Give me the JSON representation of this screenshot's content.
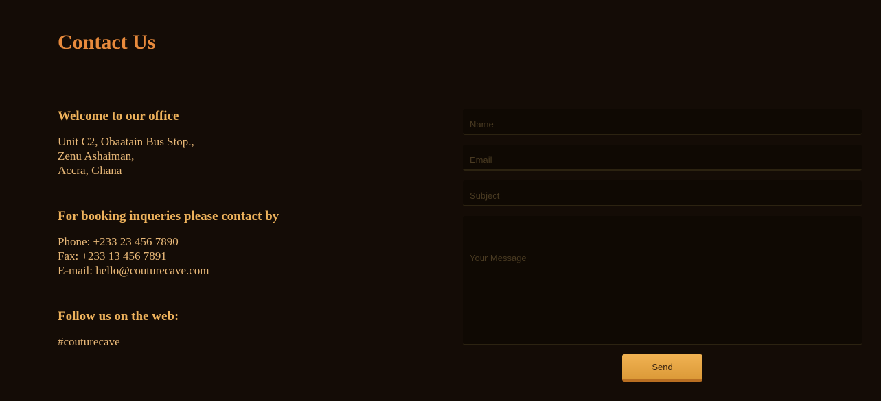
{
  "page": {
    "title": "Contact Us"
  },
  "office": {
    "heading": "Welcome to our office",
    "lines": [
      "Unit C2, Obaatain Bus Stop.,",
      "Zenu Ashaiman,",
      "Accra, Ghana"
    ]
  },
  "booking": {
    "heading": "For booking inqueries please contact by",
    "phone": "Phone: +233 23 456 7890",
    "fax": "Fax: +233 13 456 7891",
    "email": "E-mail: hello@couturecave.com"
  },
  "follow": {
    "heading": "Follow us on the web:",
    "handle": "#couturecave"
  },
  "form": {
    "name_placeholder": "Name",
    "email_placeholder": "Email",
    "subject_placeholder": "Subject",
    "message_placeholder": "Your Message",
    "send_label": "Send"
  },
  "colors": {
    "background": "#140c06",
    "title": "#e88a3c",
    "heading": "#efb35c",
    "button": "#e8a94a"
  }
}
